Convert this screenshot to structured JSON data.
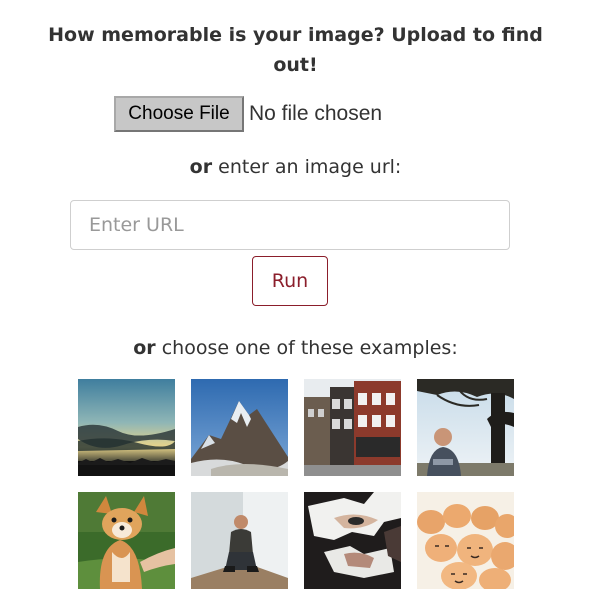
{
  "header": {
    "title": "How memorable is your image? Upload to find out!"
  },
  "upload": {
    "choose_file_label": "Choose File",
    "file_status": "No file chosen"
  },
  "url_section": {
    "or_label": "or",
    "prompt": " enter an image url:",
    "placeholder": "Enter URL",
    "run_label": "Run"
  },
  "examples": {
    "or_label": "or",
    "prompt": " choose one of these examples:",
    "items": [
      {
        "subject": "sunset sky over landscape"
      },
      {
        "subject": "snowy mountain peak"
      },
      {
        "subject": "old town street buildings"
      },
      {
        "subject": "man under tree"
      },
      {
        "subject": "chihuahua puppy and hand"
      },
      {
        "subject": "man sitting in corner"
      },
      {
        "subject": "torn paper face portrait"
      },
      {
        "subject": "eggs with drawn faces"
      }
    ]
  },
  "colors": {
    "accent": "#8b1e2b",
    "text": "#333333",
    "border": "#cfcfcf"
  }
}
